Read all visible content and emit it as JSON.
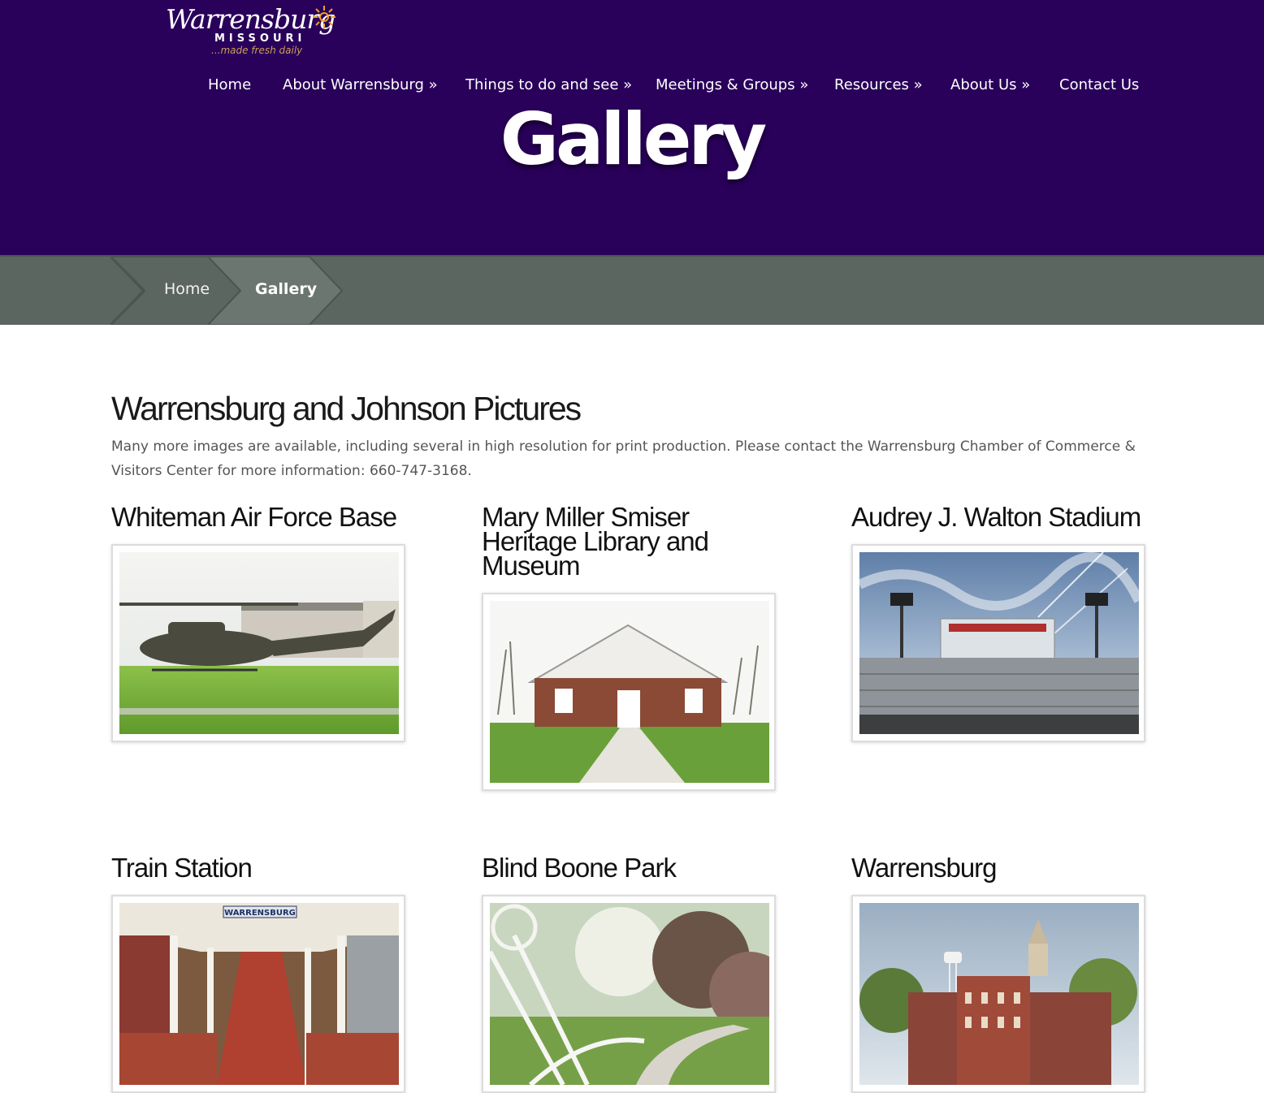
{
  "logo": {
    "script": "Warrensburg",
    "state": "MISSOURI",
    "tagline": "...made fresh daily"
  },
  "nav": {
    "items": [
      {
        "label": "Home"
      },
      {
        "label": "About Warrensburg »"
      },
      {
        "label": "Things to do and see »"
      },
      {
        "label": "Meetings & Groups »"
      },
      {
        "label": "Resources »"
      },
      {
        "label": "About Us »"
      },
      {
        "label": "Contact Us"
      }
    ]
  },
  "hero": {
    "title": "Gallery"
  },
  "breadcrumb": {
    "home": "Home",
    "current": "Gallery"
  },
  "section": {
    "title": "Warrensburg and Johnson Pictures",
    "intro": "Many more images are available, including several in high resolution for print production.  Please contact the Warrensburg Chamber of Commerce & Visitors Center for more information: 660-747-3168."
  },
  "gallery": [
    {
      "title": "Whiteman Air Force Base",
      "icon": "helicopter-photo"
    },
    {
      "title": "Mary Miller Smiser Heritage Library and Museum",
      "icon": "library-photo"
    },
    {
      "title": "Audrey J. Walton Stadium",
      "icon": "stadium-photo"
    },
    {
      "title": "Train Station",
      "icon": "train-station-photo"
    },
    {
      "title": "Blind Boone Park",
      "icon": "park-photo"
    },
    {
      "title": "Warrensburg",
      "icon": "town-photo"
    }
  ],
  "photo_text": {
    "station_sign": "WARRENSBURG"
  },
  "colors": {
    "header_bg": "#29005a",
    "breadcrumb_bg": "#5b6660",
    "text_muted": "#555555"
  }
}
